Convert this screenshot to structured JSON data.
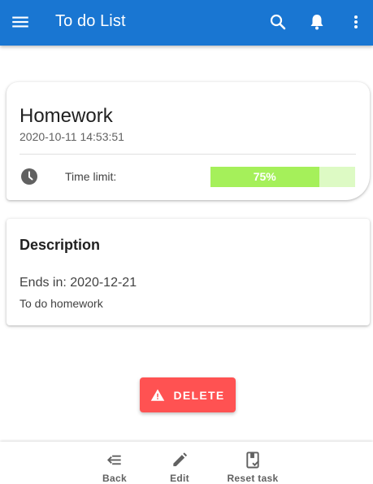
{
  "appbar": {
    "title": "To do List",
    "background": "#1976d2",
    "icons": [
      "menu-icon",
      "search-icon",
      "bell-icon",
      "more-vert-icon"
    ]
  },
  "task": {
    "title": "Homework",
    "created": "2020-10-11 14:53:51",
    "time_limit_label": "Time limit:",
    "progress_percent": 75,
    "progress_text": "75%",
    "progress_color": "#a5f05a",
    "progress_track_color": "#ddfac4"
  },
  "description": {
    "heading": "Description",
    "ends": "Ends in: 2020-12-21",
    "body": "To do homework"
  },
  "delete_button": {
    "label": "DELETE",
    "color": "#ff5252",
    "icon": "warning-icon"
  },
  "bottom_nav": {
    "items": [
      {
        "label": "Back",
        "icon": "back-arrow-icon"
      },
      {
        "label": "Edit",
        "icon": "pencil-icon"
      },
      {
        "label": "Reset task",
        "icon": "reset-task-icon"
      }
    ]
  }
}
